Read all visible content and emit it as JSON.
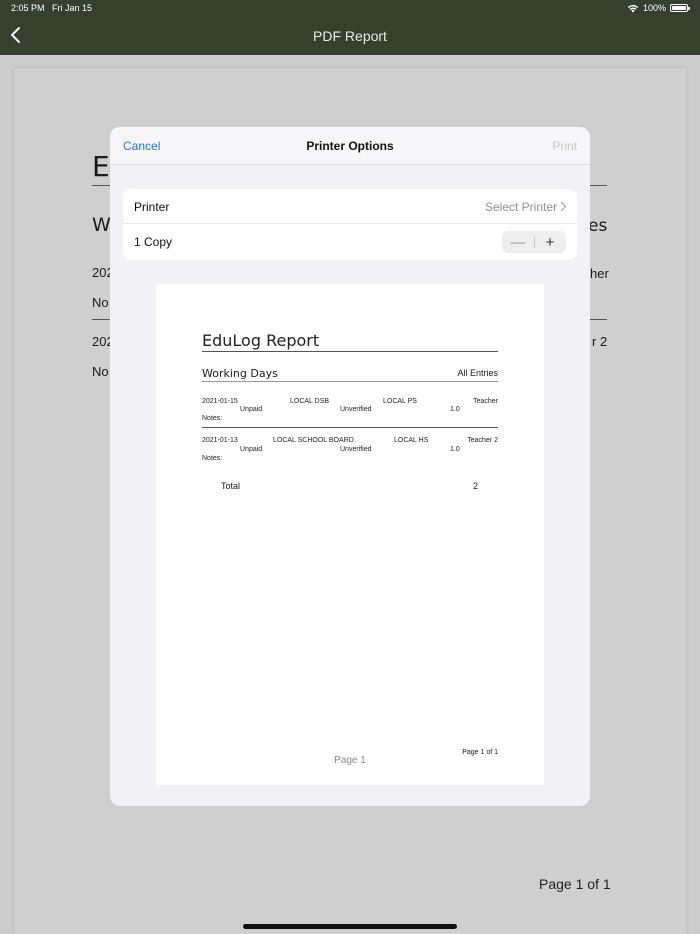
{
  "status_bar": {
    "time": "2:05 PM",
    "date": "Fri Jan 15",
    "battery": "100%"
  },
  "nav": {
    "title": "PDF Report",
    "back_icon": "chevron-left-icon"
  },
  "background_doc": {
    "title_fragment": "E",
    "subtitle_left": "W",
    "subtitle_right": "es",
    "row1_date": "202",
    "row1_right": "her",
    "row1_notes": "No",
    "row2_date": "202",
    "row2_right": "r 2",
    "row2_notes": "No",
    "footer": "Page 1 of 1"
  },
  "modal": {
    "cancel_label": "Cancel",
    "title": "Printer Options",
    "print_label": "Print",
    "printer_label": "Printer",
    "printer_value": "Select Printer",
    "copies_label": "1 Copy",
    "minus_label": "—",
    "plus_label": "+"
  },
  "preview": {
    "title": "EduLog Report",
    "section": "Working Days",
    "filter": "All Entries",
    "entries": [
      {
        "date": "2021-01-15",
        "board": "LOCAL DSB",
        "school": "LOCAL PS",
        "role": "Teacher",
        "pay": "Unpaid",
        "status": "Unverified",
        "amount": "1.0",
        "notes": "Notes:"
      },
      {
        "date": "2021-01-13",
        "board": "LOCAL SCHOOL BOARD",
        "school": "LOCAL HS",
        "role": "Teacher 2",
        "pay": "Unpaid",
        "status": "Unverified",
        "amount": "1.0",
        "notes": "Notes:"
      }
    ],
    "total_label": "Total",
    "total_value": "2",
    "page_of": "Page 1 of 1",
    "page_label": "Page 1"
  }
}
